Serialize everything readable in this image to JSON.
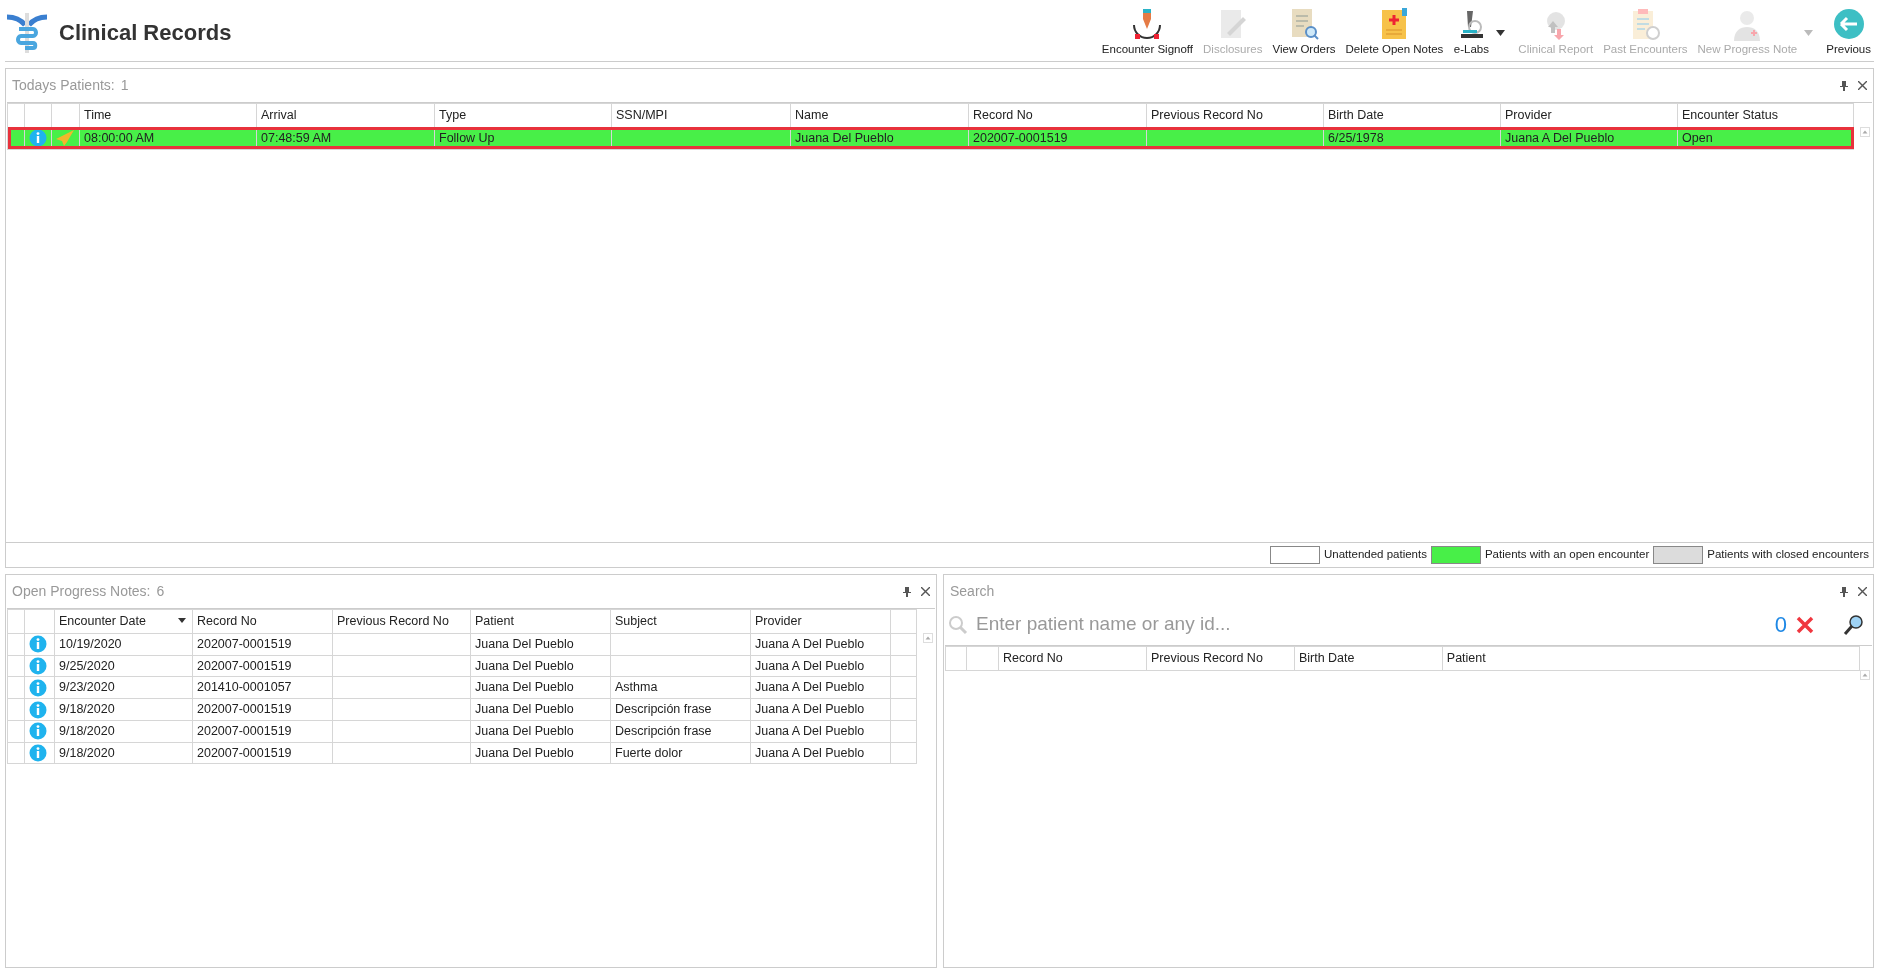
{
  "app": {
    "title": "Clinical Records"
  },
  "toolbar": [
    {
      "label": "Encounter Signoff",
      "disabled": false,
      "has_menu": false
    },
    {
      "label": "Disclosures",
      "disabled": true,
      "has_menu": false
    },
    {
      "label": "View Orders",
      "disabled": false,
      "has_menu": false
    },
    {
      "label": "Delete Open Notes",
      "disabled": false,
      "has_menu": false
    },
    {
      "label": "e-Labs",
      "disabled": false,
      "has_menu": true
    },
    {
      "label": "Clinical Report",
      "disabled": true,
      "has_menu": false
    },
    {
      "label": "Past Encounters",
      "disabled": true,
      "has_menu": false
    },
    {
      "label": "New Progress Note",
      "disabled": true,
      "has_menu": true
    },
    {
      "label": "Previous",
      "disabled": false,
      "has_menu": false
    }
  ],
  "todays_patients": {
    "title": "Todays Patients:",
    "count": "1",
    "columns": [
      "Time",
      "Arrival",
      "Type",
      "SSN/MPI",
      "Name",
      "Record No",
      "Previous Record No",
      "Birth Date",
      "Provider",
      "Encounter Status"
    ],
    "rows": [
      {
        "selected": true,
        "color": "#48ef48",
        "cells": [
          "08:00:00 AM",
          "07:48:59 AM",
          "Follow Up",
          "",
          "Juana Del Pueblo",
          "202007-0001519",
          "",
          "6/25/1978",
          "Juana A Del Pueblo",
          "Open"
        ]
      }
    ]
  },
  "legend": [
    {
      "label": "Unattended patients",
      "color": "#ffffff"
    },
    {
      "label": "Patients with an open encounter",
      "color": "#48ef48"
    },
    {
      "label": "Patients with closed encounters",
      "color": "#dcdcdc"
    }
  ],
  "open_progress_notes": {
    "title": "Open Progress Notes:",
    "count": "6",
    "columns": [
      {
        "label": "Encounter Date",
        "sorted": true
      },
      {
        "label": "Record No",
        "sorted": false
      },
      {
        "label": "Previous Record No",
        "sorted": false
      },
      {
        "label": "Patient",
        "sorted": false
      },
      {
        "label": "Subject",
        "sorted": false
      },
      {
        "label": "Provider",
        "sorted": false
      }
    ],
    "rows": [
      [
        "10/19/2020",
        "202007-0001519",
        "",
        "Juana Del Pueblo",
        "",
        "Juana A Del Pueblo"
      ],
      [
        "9/25/2020",
        "202007-0001519",
        "",
        "Juana Del Pueblo",
        "",
        "Juana A Del Pueblo"
      ],
      [
        "9/23/2020",
        "201410-0001057",
        "",
        "Juana Del Pueblo",
        "Asthma",
        "Juana A Del Pueblo"
      ],
      [
        "9/18/2020",
        "202007-0001519",
        "",
        "Juana Del Pueblo",
        "Descripción frase",
        "Juana A Del Pueblo"
      ],
      [
        "9/18/2020",
        "202007-0001519",
        "",
        "Juana Del Pueblo",
        "Descripción frase",
        "Juana A Del Pueblo"
      ],
      [
        "9/18/2020",
        "202007-0001519",
        "",
        "Juana Del Pueblo",
        "Fuerte dolor",
        "Juana A Del Pueblo"
      ]
    ]
  },
  "search": {
    "title": "Search",
    "placeholder": "Enter patient name or any id...",
    "count": "0",
    "columns": [
      "Record No",
      "Previous Record No",
      "Birth Date",
      "Patient"
    ]
  }
}
